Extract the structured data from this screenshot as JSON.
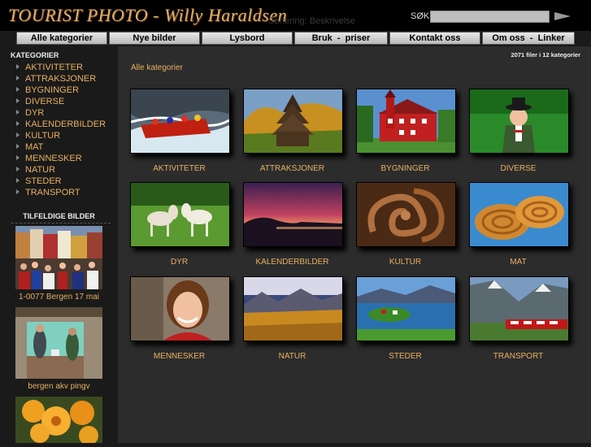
{
  "header": {
    "logo": "TOURIST PHOTO  - Willy Haraldsen",
    "sortering": "Sortering: Beskrivelse",
    "search_label": "SØK:",
    "search_value": ""
  },
  "nav": [
    {
      "label": "Alle kategorier"
    },
    {
      "label": "Nye bilder"
    },
    {
      "label": "Lysbord"
    },
    {
      "label": "Bruk  -  priser"
    },
    {
      "label": "Kontakt oss"
    },
    {
      "label": "Om oss  -  Linker"
    }
  ],
  "sidebar": {
    "title": "KATEGORIER",
    "items": [
      "AKTIVITETER",
      "ATTRAKSJONER",
      "BYGNINGER",
      "DIVERSE",
      "DYR",
      "KALENDERBILDER",
      "KULTUR",
      "MAT",
      "MENNESKER",
      "NATUR",
      "STEDER",
      "TRANSPORT"
    ],
    "random_title": "TILFELDIGE BILDER",
    "random": [
      {
        "caption": "1-0077 Bergen 17 mai"
      },
      {
        "caption": "bergen akv pingv"
      },
      {
        "caption": ""
      }
    ]
  },
  "main": {
    "counter": "2071 filer i 12 kategorier",
    "breadcrumb": "Alle kategorier",
    "categories": [
      "AKTIVITETER",
      "ATTRAKSJONER",
      "BYGNINGER",
      "DIVERSE",
      "DYR",
      "KALENDERBILDER",
      "KULTUR",
      "MAT",
      "MENNESKER",
      "NATUR",
      "STEDER",
      "TRANSPORT"
    ]
  },
  "colors": {
    "accent": "#e8b060",
    "logo": "#e0b070",
    "main_bg": "#2c2c2c",
    "sidebar_bg": "#1a1a1a"
  }
}
